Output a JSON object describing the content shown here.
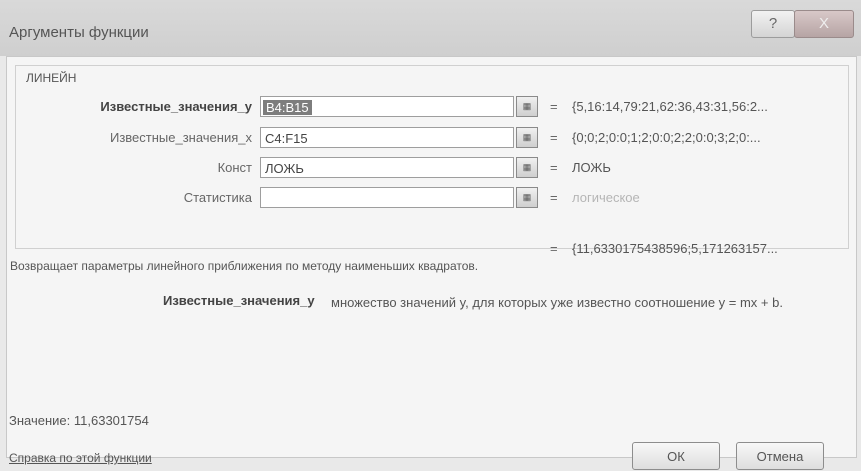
{
  "window": {
    "title": "Аргументы функции",
    "help_glyph": "?",
    "close_glyph": "X"
  },
  "function": {
    "name": "ЛИНЕЙН"
  },
  "arguments": [
    {
      "label": "Известные_значения_y",
      "input": "B4:B15",
      "equals": "=",
      "value": "{5,16:14,79:21,62:36,43:31,56:2..."
    },
    {
      "label": "Известные_значения_x",
      "input": "C4:F15",
      "equals": "=",
      "value": "{0;0;2;0:0;1;2;0:0;2;2;0:0;3;2;0:..."
    },
    {
      "label": "Конст",
      "input": "ЛОЖЬ",
      "equals": "=",
      "value": "ЛОЖЬ"
    },
    {
      "label": "Статистика",
      "input": "",
      "equals": "=",
      "value": "логическое"
    }
  ],
  "result": {
    "equals": "=",
    "value": "{11,6330175438596;5,171263157..."
  },
  "description": "Возвращает параметры линейного приближения по методу наименьших квадратов.",
  "argument_help": {
    "name": "Известные_значения_y",
    "text": "множество значений y, для которых уже известно соотношение y = mx + b."
  },
  "value_line": "Значение:  11,63301754",
  "help_link": "Справка по этой функции",
  "buttons": {
    "ok": "ОК",
    "cancel": "Отмена"
  },
  "icons": {
    "ref_button": "range-select-icon"
  }
}
